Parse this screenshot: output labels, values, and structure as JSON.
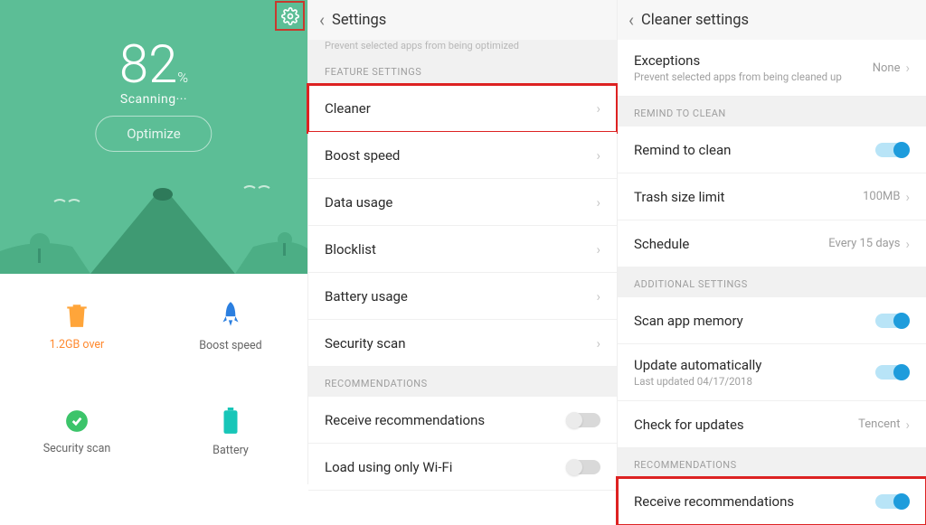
{
  "pane1": {
    "score": "82",
    "pct": "%",
    "scanning": "Scanning···",
    "optimize": "Optimize",
    "tiles": {
      "storage": "1.2GB over",
      "boost": "Boost speed",
      "scan": "Security scan",
      "battery": "Battery"
    }
  },
  "pane2": {
    "title": "Settings",
    "cutoff": "Prevent selected apps from being optimized",
    "sect_features": "FEATURE SETTINGS",
    "items": {
      "cleaner": "Cleaner",
      "boost": "Boost speed",
      "data": "Data usage",
      "block": "Blocklist",
      "batt": "Battery usage",
      "sec": "Security scan"
    },
    "sect_recs": "RECOMMENDATIONS",
    "recs": {
      "recv": "Receive recommendations",
      "wifi": "Load using only Wi-Fi"
    }
  },
  "pane3": {
    "title": "Cleaner settings",
    "exc_title": "Exceptions",
    "exc_sub": "Prevent selected apps from being cleaned up",
    "exc_val": "None",
    "sect_remind": "REMIND TO CLEAN",
    "remind": "Remind to clean",
    "trash": "Trash size limit",
    "trash_val": "100MB",
    "schedule": "Schedule",
    "schedule_val": "Every 15 days",
    "sect_add": "ADDITIONAL SETTINGS",
    "scanmem": "Scan app memory",
    "upd": "Update automatically",
    "upd_sub": "Last updated 04/17/2018",
    "check": "Check for updates",
    "check_val": "Tencent",
    "sect_recs": "RECOMMENDATIONS",
    "recv": "Receive recommendations"
  }
}
